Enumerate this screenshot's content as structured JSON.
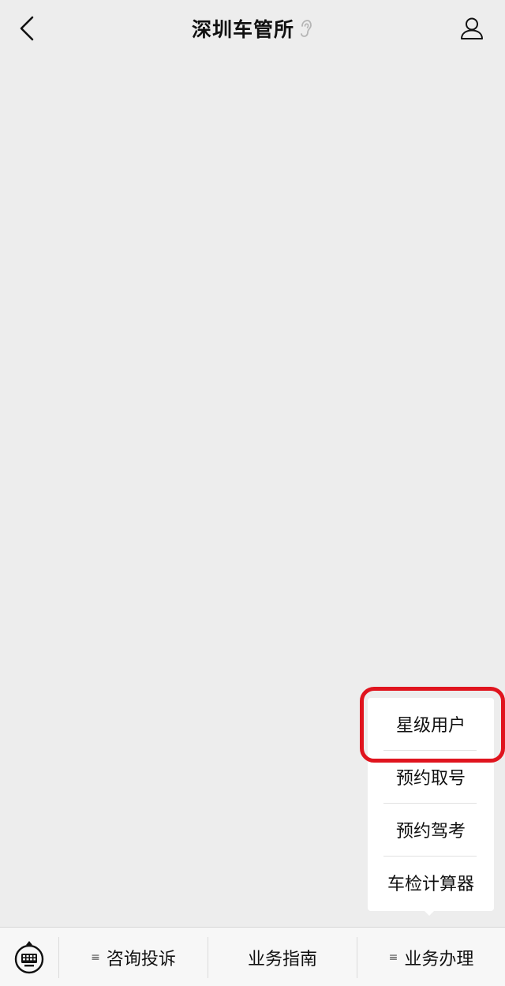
{
  "header": {
    "title": "深圳车管所",
    "back_icon": "chevron-left-icon",
    "listen_icon": "ear-icon",
    "profile_icon": "user-icon"
  },
  "submenu": {
    "items": [
      {
        "label": "星级用户"
      },
      {
        "label": "预约取号"
      },
      {
        "label": "预约驾考"
      },
      {
        "label": "车检计算器"
      }
    ]
  },
  "highlight": {
    "color": "#e0141e"
  },
  "bottom_bar": {
    "keyboard_icon": "keyboard-icon",
    "menus": [
      {
        "label": "咨询投诉",
        "has_submenu": true
      },
      {
        "label": "业务指南",
        "has_submenu": false
      },
      {
        "label": "业务办理",
        "has_submenu": true
      }
    ]
  }
}
